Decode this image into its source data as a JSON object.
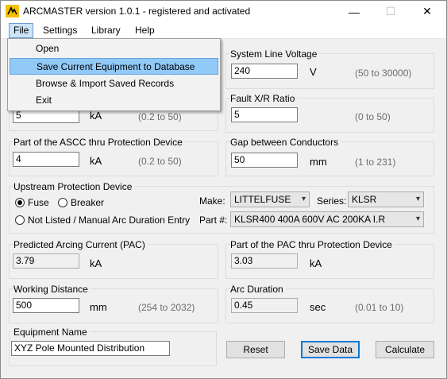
{
  "window": {
    "title": "ARCMASTER version 1.0.1 - registered and activated",
    "min_glyph": "—",
    "max_glyph": "☐",
    "close_glyph": "✕"
  },
  "menu": {
    "file": "File",
    "settings": "Settings",
    "library": "Library",
    "help": "Help"
  },
  "file_menu": {
    "items": [
      "Open",
      "Save Current Equipment to Database",
      "Browse & Import Saved Records",
      "Exit"
    ],
    "highlighted": "Save Current Equipment to Database"
  },
  "ascc": {
    "value": "5",
    "unit": "kA",
    "range": "(0.2 to 50)"
  },
  "system_voltage": {
    "label": "System Line Voltage",
    "value": "240",
    "unit": "V",
    "range": "(50 to 30000)"
  },
  "fault_xr": {
    "label": "Fault X/R Ratio",
    "value": "5",
    "range": "(0 to 50)"
  },
  "ascc_part": {
    "label": "Part of the ASCC thru Protection Device",
    "value": "4",
    "unit": "kA",
    "range": "(0.2 to 50)"
  },
  "gap": {
    "label": "Gap between Conductors",
    "value": "50",
    "unit": "mm",
    "range": "(1 to 231)"
  },
  "upstream": {
    "label": "Upstream Protection Device",
    "fuse": "Fuse",
    "breaker": "Breaker",
    "not_listed": "Not Listed / Manual Arc Duration Entry",
    "make_label": "Make:",
    "make_value": "LITTELFUSE",
    "series_label": "Series:",
    "series_value": "KLSR",
    "part_label": "Part #:",
    "part_value": "KLSR400 400A 600V AC 200KA I.R",
    "selected": "Fuse"
  },
  "pac": {
    "label": "Predicted Arcing Current (PAC)",
    "value": "3.79",
    "unit": "kA"
  },
  "pac_part": {
    "label": "Part of the PAC thru Protection Device",
    "value": "3.03",
    "unit": "kA"
  },
  "working_distance": {
    "label": "Working Distance",
    "value": "500",
    "unit": "mm",
    "range": "(254 to 2032)"
  },
  "arc_duration": {
    "label": "Arc Duration",
    "value": "0.45",
    "unit": "sec",
    "range": "(0.01 to 10)"
  },
  "equipment": {
    "label": "Equipment Name",
    "value": "XYZ Pole Mounted Distribution"
  },
  "buttons": {
    "reset": "Reset",
    "save": "Save Data",
    "calculate": "Calculate"
  }
}
